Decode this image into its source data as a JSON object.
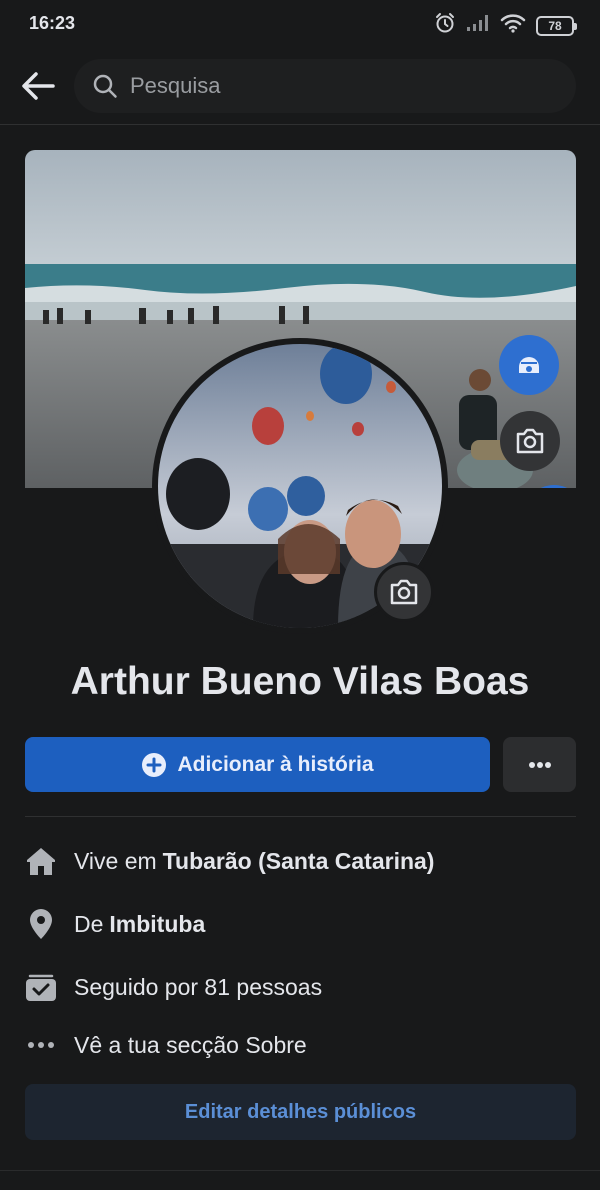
{
  "status_bar": {
    "time": "16:23",
    "battery": "78"
  },
  "search": {
    "placeholder": "Pesquisa"
  },
  "profile": {
    "name": "Arthur Bueno Vilas Boas"
  },
  "actions": {
    "add_story_label": "Adicionar à história",
    "more_label": "•••"
  },
  "details": {
    "lives_prefix": "Vive em",
    "lives_place": "Tubarão (Santa Catarina)",
    "from_prefix": "De",
    "from_place": "Imbituba",
    "followers": "Seguido por 81 pessoas",
    "about": "Vê a tua secção Sobre"
  },
  "edit_button": "Editar detalhes públicos",
  "colors": {
    "background": "#18191a",
    "primary_button": "#1d5fbf",
    "link": "#5b8fd6"
  },
  "icons": [
    "arrow-left-icon",
    "search-icon",
    "alarm-icon",
    "signal-icon",
    "wifi-icon",
    "battery-icon",
    "avatar-icon",
    "camera-icon",
    "plus-circle-icon",
    "more-icon",
    "home-icon",
    "location-pin-icon",
    "followers-icon",
    "dots-icon"
  ]
}
